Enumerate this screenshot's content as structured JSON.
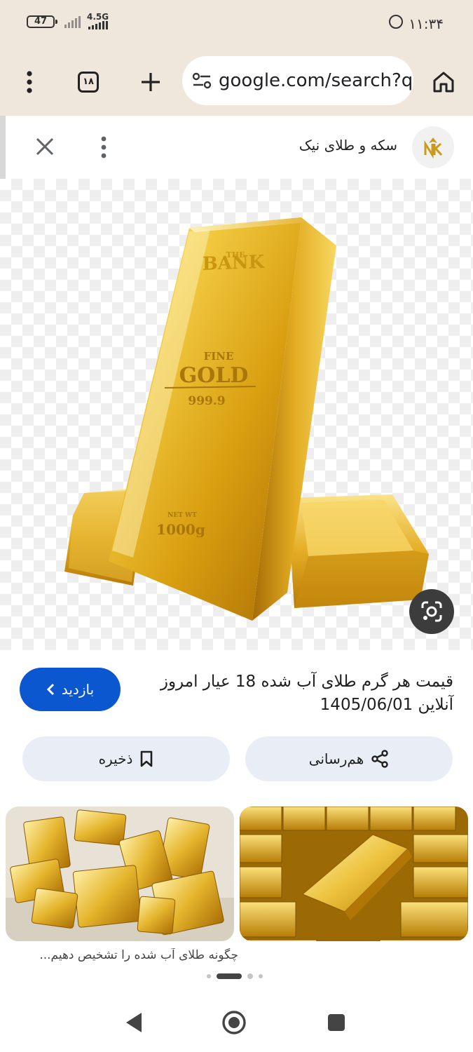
{
  "status_bar": {
    "battery": "47",
    "network": "4.5G",
    "time": "۱۱:۳۴",
    "icons": [
      "battery-icon",
      "signal-icon",
      "whatsapp-icon"
    ]
  },
  "browser": {
    "url": "google.com/search?q",
    "tab_count": "۱۸",
    "icons": [
      "menu-icon",
      "tabs-icon",
      "new-tab-icon",
      "site-info-icon",
      "home-icon"
    ]
  },
  "image_viewer": {
    "site_name": "سکه و طلای نیک",
    "image_texts": {
      "brand": "THE BANK",
      "fine": "FINE",
      "gold": "GOLD",
      "purity": "999.9",
      "net_wt": "NET WT",
      "weight": "1000g"
    },
    "title_line1": "قیمت هر گرم طلای آب شده 18 عیار امروز",
    "title_line2": "آنلاین 1405/06/01",
    "visit_label": "بازدید",
    "share_label": "هم‌رسانی",
    "save_label": "ذخیره",
    "related_caption": "چگونه طلای آب شده را تشخیص دهیم...",
    "pagination": {
      "current": 2,
      "total": 4
    }
  },
  "colors": {
    "chrome_bg": "#f0e7dc",
    "accent": "#0b57d0",
    "pill_bg": "#e9eef6",
    "gold": "#d9a91e"
  }
}
